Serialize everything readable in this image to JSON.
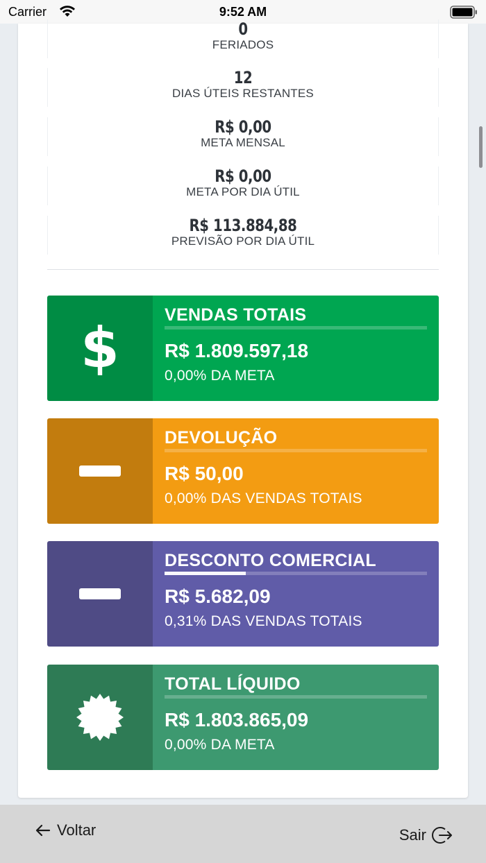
{
  "status_bar": {
    "carrier": "Carrier",
    "time": "9:52 AM"
  },
  "stats": [
    {
      "value": "0",
      "label": "FERIADOS"
    },
    {
      "value": "12",
      "label": "DIAS ÚTEIS RESTANTES"
    },
    {
      "value": "R$ 0,00",
      "label": "META MENSAL"
    },
    {
      "value": "R$ 0,00",
      "label": "META POR DIA ÚTIL"
    },
    {
      "value": "R$ 113.884,88",
      "label": "PREVISÃO POR DIA ÚTIL"
    }
  ],
  "kpis": [
    {
      "title": "VENDAS TOTAIS",
      "value": "R$ 1.809.597,18",
      "description": "0,00% DA META",
      "icon": "dollar-icon",
      "progress": 0.0,
      "color_icon": "#008c44",
      "color_body": "#00a651"
    },
    {
      "title": "DEVOLUÇÃO",
      "value": "R$ 50,00",
      "description": "0,00% DAS VENDAS TOTAIS",
      "icon": "minus-icon",
      "progress": 0.0,
      "color_icon": "#c27c0e",
      "color_body": "#f39c12"
    },
    {
      "title": "DESCONTO COMERCIAL",
      "value": "R$ 5.682,09",
      "description": "0,31% DAS VENDAS TOTAIS",
      "icon": "minus-icon",
      "progress": 0.31,
      "color_icon": "#4f4b85",
      "color_body": "#605ca8"
    },
    {
      "title": "TOTAL LÍQUIDO",
      "value": "R$ 1.803.865,09",
      "description": "0,00% DA META",
      "icon": "certificate-icon",
      "progress": 0.0,
      "color_icon": "#2e7b55",
      "color_body": "#3d9970"
    }
  ],
  "footer": {
    "back_label": "Voltar",
    "logout_label": "Sair"
  }
}
